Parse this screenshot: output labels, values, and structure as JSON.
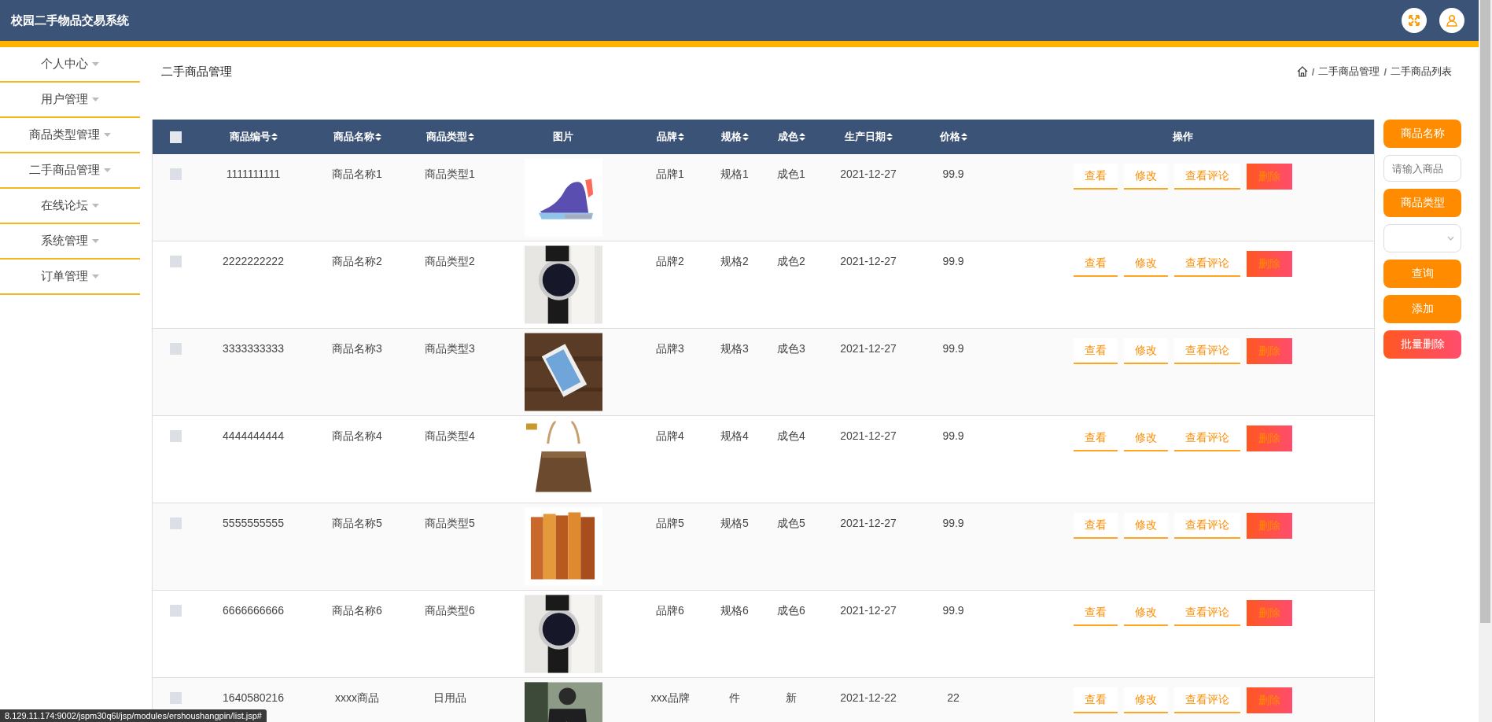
{
  "header": {
    "title": "校园二手物品交易系统"
  },
  "sidebar": {
    "items": [
      {
        "label": "个人中心"
      },
      {
        "label": "用户管理"
      },
      {
        "label": "商品类型管理"
      },
      {
        "label": "二手商品管理"
      },
      {
        "label": "在线论坛"
      },
      {
        "label": "系统管理"
      },
      {
        "label": "订单管理"
      }
    ]
  },
  "page_title": "二手商品管理",
  "breadcrumb": [
    {
      "kind": "separator",
      "text": "/"
    },
    {
      "kind": "link",
      "text": "二手商品管理"
    },
    {
      "kind": "separator",
      "text": "/"
    },
    {
      "kind": "link",
      "text": "二手商品列表"
    }
  ],
  "table": {
    "select_all_checked": false,
    "columns": [
      {
        "label": "商品编号",
        "kind": "text",
        "sortable": true
      },
      {
        "label": "商品名称",
        "kind": "text",
        "sortable": true
      },
      {
        "label": "商品类型",
        "kind": "text",
        "sortable": true
      },
      {
        "label": "图片",
        "kind": "picture",
        "sortable": false
      },
      {
        "label": "品牌",
        "kind": "text",
        "sortable": true
      },
      {
        "label": "规格",
        "kind": "text",
        "sortable": true
      },
      {
        "label": "成色",
        "kind": "text",
        "sortable": true
      },
      {
        "label": "生产日期",
        "kind": "text",
        "sortable": true
      },
      {
        "label": "价格",
        "kind": "text",
        "sortable": true
      },
      {
        "label": "操作",
        "kind": "actions",
        "sortable": false
      }
    ],
    "rows": [
      {
        "checked": false,
        "cells": [
          "1111111111",
          "商品名称1",
          "商品类型1",
          "",
          "品牌1",
          "规格1",
          "成色1",
          "2021-12-27",
          "99.9"
        ],
        "image": {
          "kind": "picture"
        },
        "actions": [
          {
            "label": "查看",
            "kind": "link"
          },
          {
            "label": "修改",
            "kind": "link"
          },
          {
            "label": "查看评论",
            "kind": "link"
          },
          {
            "label": "删除",
            "kind": "danger"
          }
        ]
      },
      {
        "checked": false,
        "cells": [
          "2222222222",
          "商品名称2",
          "商品类型2",
          "",
          "品牌2",
          "规格2",
          "成色2",
          "2021-12-27",
          "99.9"
        ],
        "image": {
          "kind": "picture"
        },
        "actions": [
          {
            "label": "查看",
            "kind": "link"
          },
          {
            "label": "修改",
            "kind": "link"
          },
          {
            "label": "查看评论",
            "kind": "link"
          },
          {
            "label": "删除",
            "kind": "danger"
          }
        ]
      },
      {
        "checked": false,
        "cells": [
          "3333333333",
          "商品名称3",
          "商品类型3",
          "",
          "品牌3",
          "规格3",
          "成色3",
          "2021-12-27",
          "99.9"
        ],
        "image": {
          "kind": "picture"
        },
        "actions": [
          {
            "label": "查看",
            "kind": "link"
          },
          {
            "label": "修改",
            "kind": "link"
          },
          {
            "label": "查看评论",
            "kind": "link"
          },
          {
            "label": "删除",
            "kind": "danger"
          }
        ]
      },
      {
        "checked": false,
        "cells": [
          "4444444444",
          "商品名称4",
          "商品类型4",
          "",
          "品牌4",
          "规格4",
          "成色4",
          "2021-12-27",
          "99.9"
        ],
        "image": {
          "kind": "picture"
        },
        "actions": [
          {
            "label": "查看",
            "kind": "link"
          },
          {
            "label": "修改",
            "kind": "link"
          },
          {
            "label": "查看评论",
            "kind": "link"
          },
          {
            "label": "删除",
            "kind": "danger"
          }
        ]
      },
      {
        "checked": false,
        "cells": [
          "5555555555",
          "商品名称5",
          "商品类型5",
          "",
          "品牌5",
          "规格5",
          "成色5",
          "2021-12-27",
          "99.9"
        ],
        "image": {
          "kind": "picture"
        },
        "actions": [
          {
            "label": "查看",
            "kind": "link"
          },
          {
            "label": "修改",
            "kind": "link"
          },
          {
            "label": "查看评论",
            "kind": "link"
          },
          {
            "label": "删除",
            "kind": "danger"
          }
        ]
      },
      {
        "checked": false,
        "cells": [
          "6666666666",
          "商品名称6",
          "商品类型6",
          "",
          "品牌6",
          "规格6",
          "成色6",
          "2021-12-27",
          "99.9"
        ],
        "image": {
          "kind": "picture"
        },
        "actions": [
          {
            "label": "查看",
            "kind": "link"
          },
          {
            "label": "修改",
            "kind": "link"
          },
          {
            "label": "查看评论",
            "kind": "link"
          },
          {
            "label": "删除",
            "kind": "danger"
          }
        ]
      },
      {
        "checked": false,
        "cells": [
          "1640580216",
          "xxxx商品",
          "日用品",
          "",
          "xxx品牌",
          "件",
          "新",
          "2021-12-22",
          "22"
        ],
        "image": {
          "kind": "picture"
        },
        "actions": [
          {
            "label": "查看",
            "kind": "link"
          },
          {
            "label": "修改",
            "kind": "link"
          },
          {
            "label": "查看评论",
            "kind": "link"
          },
          {
            "label": "删除",
            "kind": "danger"
          }
        ]
      }
    ]
  },
  "search_panel": [
    {
      "kind": "label",
      "text": "商品名称"
    },
    {
      "kind": "input",
      "placeholder": "请输入商品"
    },
    {
      "kind": "label",
      "text": "商品类型"
    },
    {
      "kind": "select"
    },
    {
      "kind": "button",
      "text": "查询"
    },
    {
      "kind": "button",
      "text": "添加"
    },
    {
      "kind": "danger",
      "text": "批量删除"
    }
  ],
  "status_bar": "8.129.11.174:9002/jspm30q6l/jsp/modules/ershoushangpin/list.jsp#"
}
